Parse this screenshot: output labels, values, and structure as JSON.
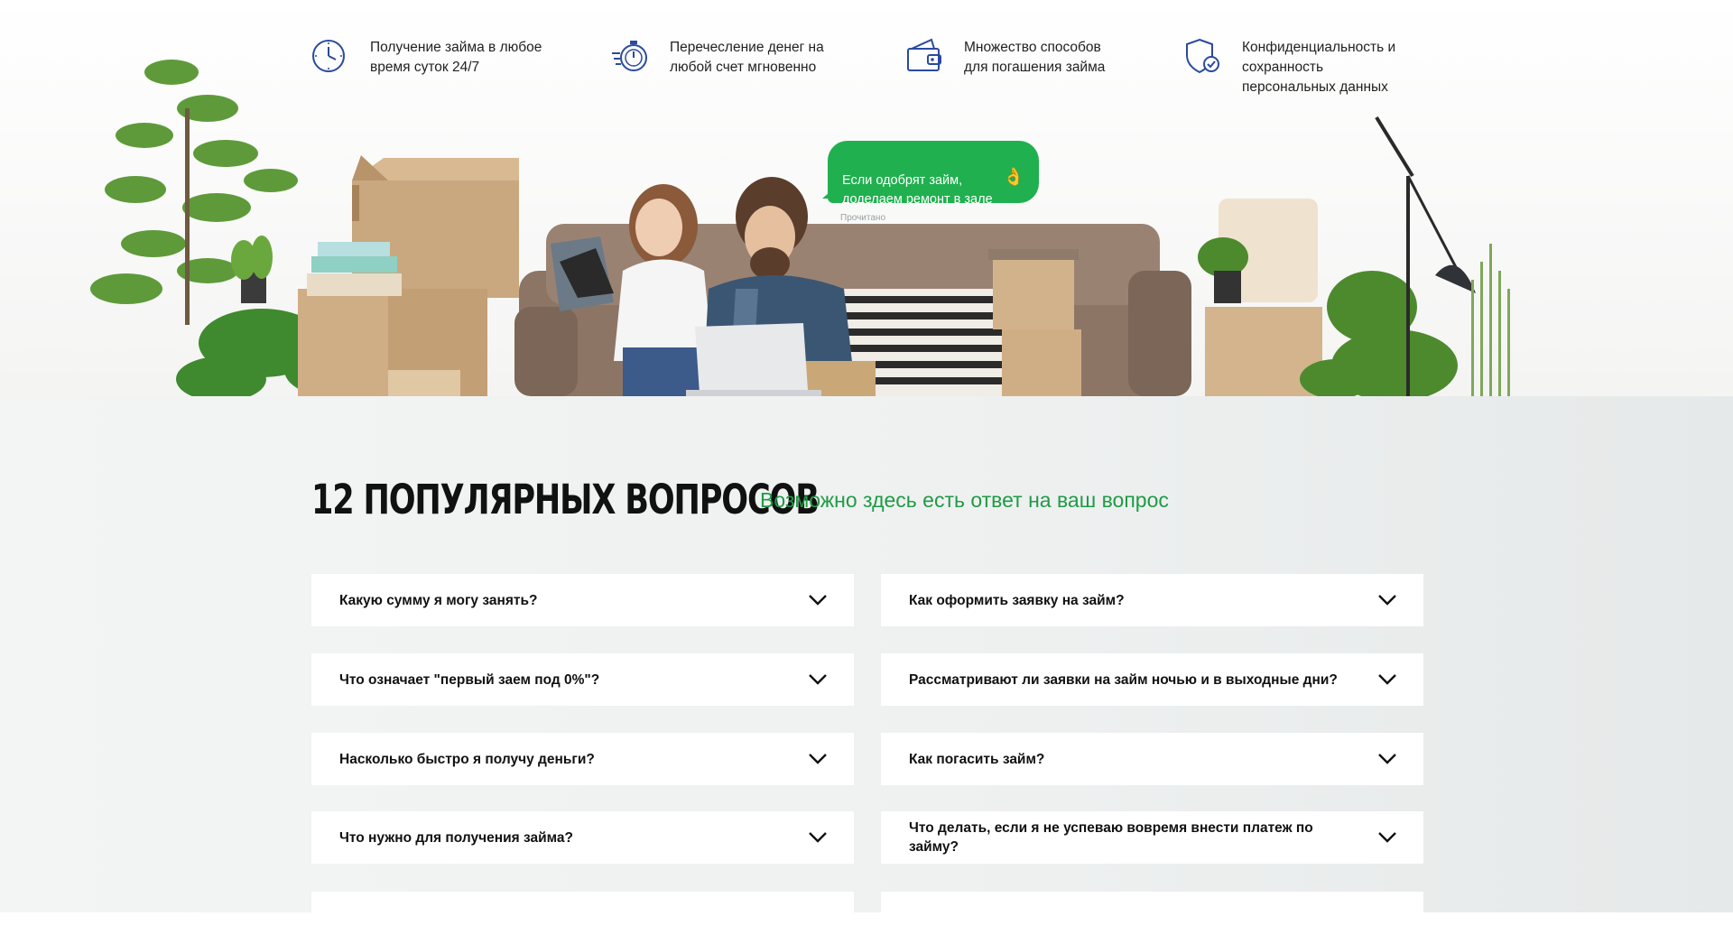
{
  "features": [
    {
      "icon": "clock-icon",
      "text": "Получение займа в любое\nвремя суток 24/7"
    },
    {
      "icon": "stopwatch-icon",
      "text": "Перечесление денег на\nлюбой счет мгновенно"
    },
    {
      "icon": "wallet-icon",
      "text": "Множество способов\nдля погашения займа"
    },
    {
      "icon": "shield-check-icon",
      "text": "Конфиденциальность и\nсохранность\nперсональных данных"
    }
  ],
  "chat": {
    "message": "Если одобрят займ,\nдоделаем ремонт в зале",
    "emoji": "👌",
    "status": "Прочитано"
  },
  "faq": {
    "title": "12 ПОПУЛЯРНЫХ ВОПРОСОВ",
    "subtitle": "Возможно здесь есть ответ на ваш вопрос",
    "questions_left": [
      "Какую сумму я могу занять?",
      "Что означает \"первый заем под 0%\"?",
      "Насколько быстро я получу деньги?",
      "Что нужно для получения займа?"
    ],
    "questions_right": [
      "Как оформить заявку на займ?",
      "Рассматривают ли заявки на займ ночью и в выходные дни?",
      "Как погасить займ?",
      "Что делать, если я не успеваю вовремя внести платеж по займу?"
    ]
  },
  "colors": {
    "accent": "#20b04f",
    "icon_blue": "#2b4a9e",
    "heading": "#111111"
  }
}
